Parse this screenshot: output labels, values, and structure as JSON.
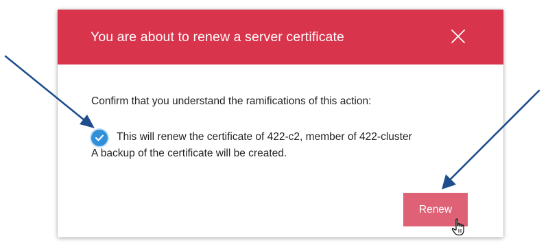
{
  "dialog": {
    "title": "You are about to renew a server certificate",
    "close_icon": "close-icon",
    "prompt": "Confirm that you understand the ramifications of this action:",
    "checkbox": {
      "checked": true,
      "label": "This will renew the certificate of 422-c2, member of 422-cluster"
    },
    "note": "A backup of the certificate will be created.",
    "renew_button": "Renew"
  },
  "colors": {
    "header": "#d8344b",
    "button": "#de6176",
    "checkbox": "#2f8fd8",
    "annotation_arrow": "#1f4e8c"
  },
  "icons": {
    "cursor": "hand-pointer-icon",
    "annotation": "arrow-annotation"
  }
}
